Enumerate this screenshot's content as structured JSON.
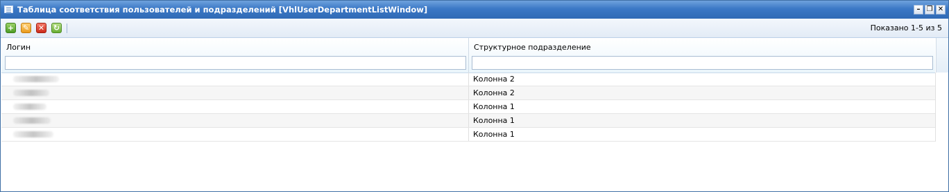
{
  "window": {
    "title": "Таблица соответствия пользователей и подразделений [VhlUserDepartmentListWindow]",
    "controls": {
      "minimize": "–",
      "restore": "❐",
      "close": "✕"
    }
  },
  "toolbar": {
    "buttons": [
      {
        "icon": "add-icon",
        "glyph": "+"
      },
      {
        "icon": "edit-icon",
        "glyph": "✎"
      },
      {
        "icon": "delete-icon",
        "glyph": "✕"
      },
      {
        "icon": "refresh-icon",
        "glyph": "↻"
      }
    ],
    "paging_text": "Показано 1-5 из 5"
  },
  "grid": {
    "columns": [
      {
        "label": "Логин",
        "filter_value": ""
      },
      {
        "label": "Структурное подразделение",
        "filter_value": ""
      }
    ],
    "rows": [
      {
        "department": "Колонна 2"
      },
      {
        "department": "Колонна 2"
      },
      {
        "department": "Колонна 1"
      },
      {
        "department": "Колонна 1"
      },
      {
        "department": "Колонна 1"
      }
    ]
  },
  "colors": {
    "titlebar": "#3b78c6",
    "toolbar_bg": "#e2ebf6",
    "header_bg": "#eaf5fb",
    "row_alt": "#f6f6f6"
  }
}
